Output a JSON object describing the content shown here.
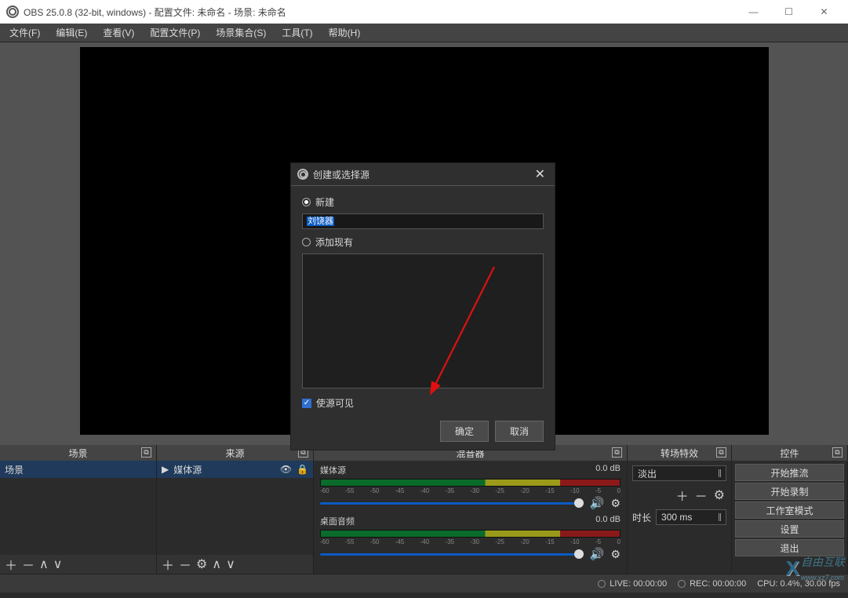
{
  "title": "OBS 25.0.8 (32-bit, windows) - 配置文件: 未命名 - 场景: 未命名",
  "win_controls": {
    "min": "—",
    "max": "☐",
    "close": "✕"
  },
  "menu": [
    "文件(F)",
    "编辑(E)",
    "查看(V)",
    "配置文件(P)",
    "场景集合(S)",
    "工具(T)",
    "帮助(H)"
  ],
  "dialog": {
    "title": "创建或选择源",
    "radio_new": "新建",
    "radio_add": "添加现有",
    "input_value": "刘饶器",
    "chk_visible": "使源可见",
    "ok": "确定",
    "cancel": "取消"
  },
  "panels": {
    "scenes": {
      "title": "场景",
      "items": [
        "场景"
      ]
    },
    "sources": {
      "title": "来源",
      "items": [
        "媒体源"
      ]
    },
    "mixer": {
      "title": "混音器",
      "channels": [
        {
          "name": "媒体源",
          "db": "0.0 dB"
        },
        {
          "name": "桌面音频",
          "db": "0.0 dB"
        }
      ],
      "ticks": [
        "-60",
        "-55",
        "-50",
        "-45",
        "-40",
        "-35",
        "-30",
        "-25",
        "-20",
        "-15",
        "-10",
        "-5",
        "0"
      ]
    },
    "transitions": {
      "title": "转场特效",
      "selected": "淡出",
      "dur_label": "时长",
      "dur_value": "300 ms"
    },
    "controls": {
      "title": "控件",
      "buttons": [
        "开始推流",
        "开始录制",
        "工作室模式",
        "设置",
        "退出"
      ]
    }
  },
  "status": {
    "live": "LIVE: 00:00:00",
    "rec": "REC: 00:00:00",
    "cpu": "CPU: 0.4%, 30.00 fps"
  },
  "watermark": {
    "brand": "自由互联",
    "url": "www.xz7.com"
  },
  "icons": {
    "plus": "＋",
    "minus": "－",
    "up": "∧",
    "down": "∨",
    "gear": "⚙",
    "play": "▶",
    "eye": "👁",
    "lock": "🔒",
    "chevdown": "⌄",
    "speaker": "🔊",
    "pop": "⧉",
    "check": "✓"
  }
}
